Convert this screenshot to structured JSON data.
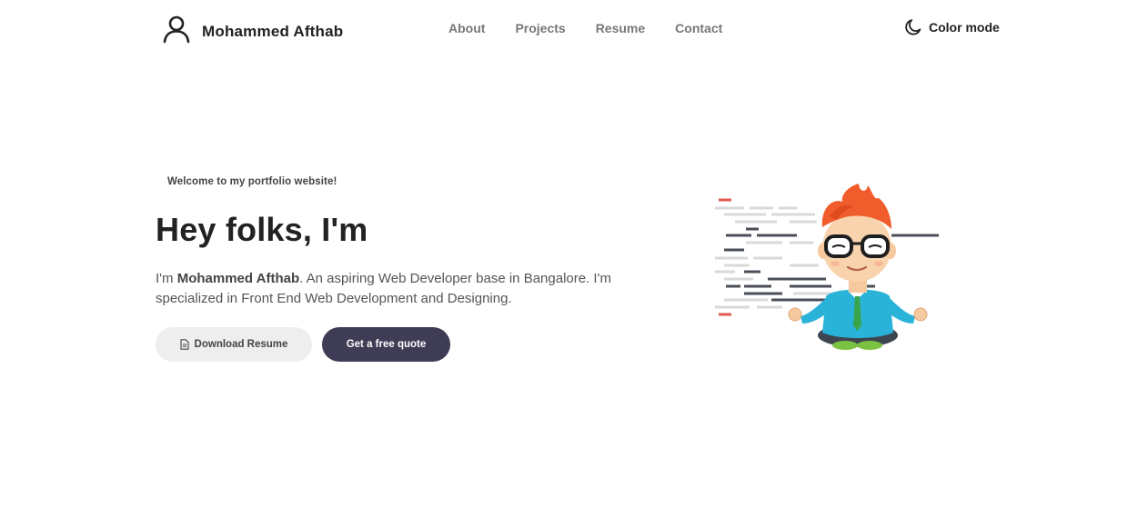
{
  "header": {
    "brand_name": "Mohammed Afthab",
    "brand_icon": "user-icon",
    "nav": [
      {
        "label": "About"
      },
      {
        "label": "Projects"
      },
      {
        "label": "Resume"
      },
      {
        "label": "Contact"
      }
    ],
    "color_mode_label": "Color mode",
    "color_mode_icon": "moon-icon"
  },
  "hero": {
    "tagline": "Welcome to my portfolio website!",
    "headline": "Hey folks, I'm",
    "intro_prefix": "I'm ",
    "intro_name": "Mohammed Afthab",
    "intro_rest": ". An aspiring Web Developer base in Bangalore. I'm specialized in Front End Web Development and Designing.",
    "download_label": "Download Resume",
    "download_icon": "document-icon",
    "quote_label": "Get a free quote"
  },
  "colors": {
    "accent_dark": "#3f3d56",
    "button_light": "#eeeeee",
    "text_primary": "#222222",
    "text_muted": "#777777"
  }
}
